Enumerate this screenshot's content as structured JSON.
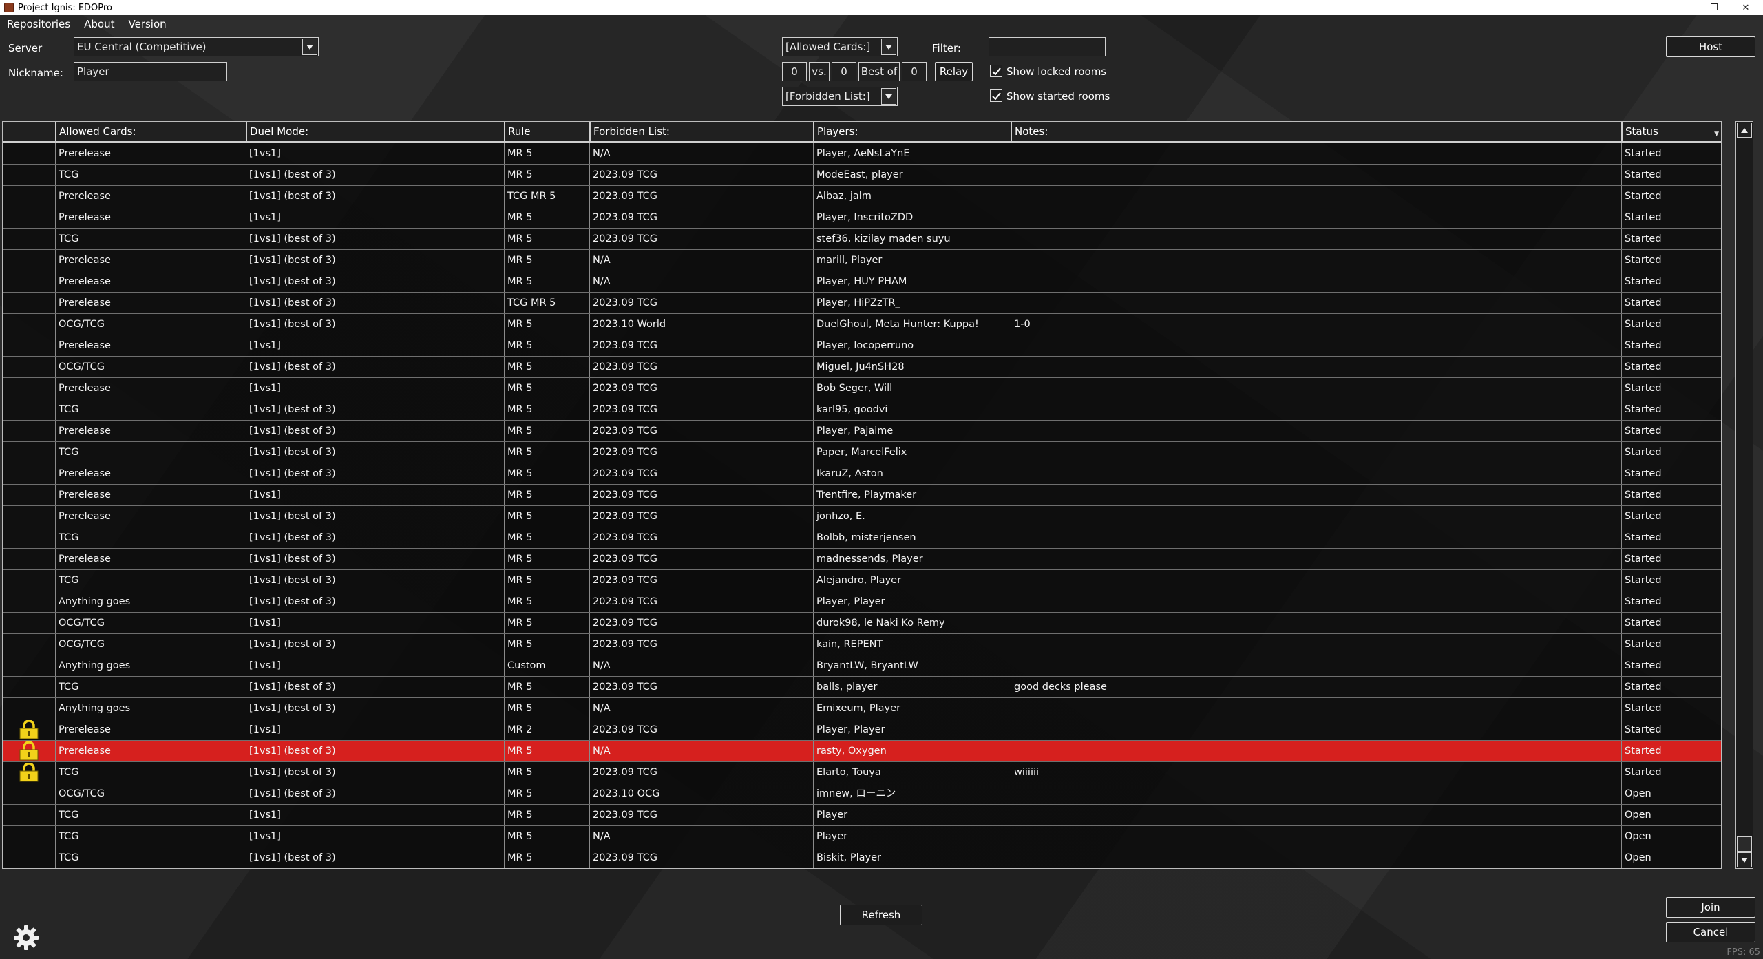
{
  "window": {
    "title": "Project Ignis: EDOPro",
    "controls": {
      "minimize": "—",
      "maximize": "❐",
      "close": "✕"
    }
  },
  "menu": [
    "Repositories",
    "About",
    "Version"
  ],
  "server": {
    "label": "Server",
    "value": "EU Central (Competitive)"
  },
  "nickname": {
    "label": "Nickname:",
    "value": "Player"
  },
  "filters": {
    "allowed_cards": "[Allowed Cards:]",
    "forbidden_list": "[Forbidden List:]",
    "vs_left": "0",
    "vs_label": "vs.",
    "vs_right": "0",
    "best_of_label": "Best of",
    "best_of_value": "0",
    "relay_label": "Relay",
    "filter_label": "Filter:",
    "filter_value": "",
    "show_locked_rooms": {
      "label": "Show locked rooms",
      "checked": true
    },
    "show_started_rooms": {
      "label": "Show started rooms",
      "checked": true
    }
  },
  "buttons": {
    "host": "Host",
    "refresh": "Refresh",
    "join": "Join",
    "cancel": "Cancel"
  },
  "table": {
    "columns": [
      "",
      "Allowed Cards:",
      "Duel Mode:",
      "Rule",
      "Forbidden List:",
      "Players:",
      "Notes:",
      "Status"
    ],
    "sort_indicator": "▼",
    "rows": [
      {
        "locked": false,
        "selected": false,
        "allowed": "Prerelease",
        "mode": "[1vs1]",
        "rule": "MR 5",
        "banlist": "N/A",
        "players": "Player, AeNsLaYnE",
        "notes": "",
        "status": "Started"
      },
      {
        "locked": false,
        "selected": false,
        "allowed": "TCG",
        "mode": "[1vs1] (best of 3)",
        "rule": "MR 5",
        "banlist": "2023.09 TCG",
        "players": "ModeEast, player",
        "notes": "",
        "status": "Started"
      },
      {
        "locked": false,
        "selected": false,
        "allowed": "Prerelease",
        "mode": "[1vs1] (best of 3)",
        "rule": "TCG MR 5",
        "banlist": "2023.09 TCG",
        "players": "Albaz, jalm",
        "notes": "",
        "status": "Started"
      },
      {
        "locked": false,
        "selected": false,
        "allowed": "Prerelease",
        "mode": "[1vs1]",
        "rule": "MR 5",
        "banlist": "2023.09 TCG",
        "players": "Player, InscritoZDD",
        "notes": "",
        "status": "Started"
      },
      {
        "locked": false,
        "selected": false,
        "allowed": "TCG",
        "mode": "[1vs1] (best of 3)",
        "rule": "MR 5",
        "banlist": "2023.09 TCG",
        "players": "stef36, kizilay maden suyu",
        "notes": "",
        "status": "Started"
      },
      {
        "locked": false,
        "selected": false,
        "allowed": "Prerelease",
        "mode": "[1vs1] (best of 3)",
        "rule": "MR 5",
        "banlist": "N/A",
        "players": "marill, Player",
        "notes": "",
        "status": "Started"
      },
      {
        "locked": false,
        "selected": false,
        "allowed": "Prerelease",
        "mode": "[1vs1] (best of 3)",
        "rule": "MR 5",
        "banlist": "N/A",
        "players": "Player, HUY PHAM",
        "notes": "",
        "status": "Started"
      },
      {
        "locked": false,
        "selected": false,
        "allowed": "Prerelease",
        "mode": "[1vs1] (best of 3)",
        "rule": "TCG MR 5",
        "banlist": "2023.09 TCG",
        "players": "Player, HiPZzTR_",
        "notes": "",
        "status": "Started"
      },
      {
        "locked": false,
        "selected": false,
        "allowed": "OCG/TCG",
        "mode": "[1vs1] (best of 3)",
        "rule": "MR 5",
        "banlist": "2023.10 World",
        "players": "DuelGhoul, Meta Hunter: Kuppa!",
        "notes": "1-0",
        "status": "Started"
      },
      {
        "locked": false,
        "selected": false,
        "allowed": "Prerelease",
        "mode": "[1vs1]",
        "rule": "MR 5",
        "banlist": "2023.09 TCG",
        "players": "Player, locoperruno",
        "notes": "",
        "status": "Started"
      },
      {
        "locked": false,
        "selected": false,
        "allowed": "OCG/TCG",
        "mode": "[1vs1] (best of 3)",
        "rule": "MR 5",
        "banlist": "2023.09 TCG",
        "players": "Miguel, Ju4nSH28",
        "notes": "",
        "status": "Started"
      },
      {
        "locked": false,
        "selected": false,
        "allowed": "Prerelease",
        "mode": "[1vs1]",
        "rule": "MR 5",
        "banlist": "2023.09 TCG",
        "players": "Bob Seger, Will",
        "notes": "",
        "status": "Started"
      },
      {
        "locked": false,
        "selected": false,
        "allowed": "TCG",
        "mode": "[1vs1] (best of 3)",
        "rule": "MR 5",
        "banlist": "2023.09 TCG",
        "players": "karl95, goodvi",
        "notes": "",
        "status": "Started"
      },
      {
        "locked": false,
        "selected": false,
        "allowed": "Prerelease",
        "mode": "[1vs1] (best of 3)",
        "rule": "MR 5",
        "banlist": "2023.09 TCG",
        "players": "Player, Pajaime",
        "notes": "",
        "status": "Started"
      },
      {
        "locked": false,
        "selected": false,
        "allowed": "TCG",
        "mode": "[1vs1] (best of 3)",
        "rule": "MR 5",
        "banlist": "2023.09 TCG",
        "players": "Paper, MarcelFelix",
        "notes": "",
        "status": "Started"
      },
      {
        "locked": false,
        "selected": false,
        "allowed": "Prerelease",
        "mode": "[1vs1] (best of 3)",
        "rule": "MR 5",
        "banlist": "2023.09 TCG",
        "players": "IkaruZ, Aston",
        "notes": "",
        "status": "Started"
      },
      {
        "locked": false,
        "selected": false,
        "allowed": "Prerelease",
        "mode": "[1vs1]",
        "rule": "MR 5",
        "banlist": "2023.09 TCG",
        "players": "Trentfire, Playmaker",
        "notes": "",
        "status": "Started"
      },
      {
        "locked": false,
        "selected": false,
        "allowed": "Prerelease",
        "mode": "[1vs1] (best of 3)",
        "rule": "MR 5",
        "banlist": "2023.09 TCG",
        "players": "jonhzo, E.",
        "notes": "",
        "status": "Started"
      },
      {
        "locked": false,
        "selected": false,
        "allowed": "TCG",
        "mode": "[1vs1] (best of 3)",
        "rule": "MR 5",
        "banlist": "2023.09 TCG",
        "players": "Bolbb, misterjensen",
        "notes": "",
        "status": "Started"
      },
      {
        "locked": false,
        "selected": false,
        "allowed": "Prerelease",
        "mode": "[1vs1] (best of 3)",
        "rule": "MR 5",
        "banlist": "2023.09 TCG",
        "players": "madnessends, Player",
        "notes": "",
        "status": "Started"
      },
      {
        "locked": false,
        "selected": false,
        "allowed": "TCG",
        "mode": "[1vs1] (best of 3)",
        "rule": "MR 5",
        "banlist": "2023.09 TCG",
        "players": "Alejandro, Player",
        "notes": "",
        "status": "Started"
      },
      {
        "locked": false,
        "selected": false,
        "allowed": "Anything goes",
        "mode": "[1vs1] (best of 3)",
        "rule": "MR 5",
        "banlist": "2023.09 TCG",
        "players": "Player, Player",
        "notes": "",
        "status": "Started"
      },
      {
        "locked": false,
        "selected": false,
        "allowed": "OCG/TCG",
        "mode": "[1vs1]",
        "rule": "MR 5",
        "banlist": "2023.09 TCG",
        "players": "durok98, le Naki Ko Remy",
        "notes": "",
        "status": "Started"
      },
      {
        "locked": false,
        "selected": false,
        "allowed": "OCG/TCG",
        "mode": "[1vs1] (best of 3)",
        "rule": "MR 5",
        "banlist": "2023.09 TCG",
        "players": "kain, REPENT",
        "notes": "",
        "status": "Started"
      },
      {
        "locked": false,
        "selected": false,
        "allowed": "Anything goes",
        "mode": "[1vs1]",
        "rule": "Custom",
        "banlist": "N/A",
        "players": "BryantLW, BryantLW",
        "notes": "",
        "status": "Started"
      },
      {
        "locked": false,
        "selected": false,
        "allowed": "TCG",
        "mode": "[1vs1] (best of 3)",
        "rule": "MR 5",
        "banlist": "2023.09 TCG",
        "players": "balls, player",
        "notes": "good decks please",
        "status": "Started"
      },
      {
        "locked": false,
        "selected": false,
        "allowed": "Anything goes",
        "mode": "[1vs1] (best of 3)",
        "rule": "MR 5",
        "banlist": "N/A",
        "players": "Emixeum, Player",
        "notes": "",
        "status": "Started"
      },
      {
        "locked": true,
        "selected": false,
        "allowed": "Prerelease",
        "mode": "[1vs1]",
        "rule": "MR 2",
        "banlist": "2023.09 TCG",
        "players": "Player, Player",
        "notes": "",
        "status": "Started"
      },
      {
        "locked": true,
        "selected": true,
        "allowed": "Prerelease",
        "mode": "[1vs1] (best of 3)",
        "rule": "MR 5",
        "banlist": "N/A",
        "players": "rasty, Oxygen",
        "notes": "",
        "status": "Started"
      },
      {
        "locked": true,
        "selected": false,
        "allowed": "TCG",
        "mode": "[1vs1] (best of 3)",
        "rule": "MR 5",
        "banlist": "2023.09 TCG",
        "players": "Elarto, Touya",
        "notes": "wiiiiii",
        "status": "Started"
      },
      {
        "locked": false,
        "selected": false,
        "allowed": "OCG/TCG",
        "mode": "[1vs1] (best of 3)",
        "rule": "MR 5",
        "banlist": "2023.10 OCG",
        "players": "imnew, ローニン",
        "notes": "",
        "status": "Open"
      },
      {
        "locked": false,
        "selected": false,
        "allowed": "TCG",
        "mode": "[1vs1]",
        "rule": "MR 5",
        "banlist": "2023.09 TCG",
        "players": "Player",
        "notes": "",
        "status": "Open"
      },
      {
        "locked": false,
        "selected": false,
        "allowed": "TCG",
        "mode": "[1vs1]",
        "rule": "MR 5",
        "banlist": "N/A",
        "players": "Player",
        "notes": "",
        "status": "Open"
      },
      {
        "locked": false,
        "selected": false,
        "allowed": "TCG",
        "mode": "[1vs1] (best of 3)",
        "rule": "MR 5",
        "banlist": "2023.09 TCG",
        "players": "Biskit, Player",
        "notes": "",
        "status": "Open"
      }
    ]
  },
  "colors": {
    "selected_row": "#d6201e",
    "lock_icon": "#f2d21a"
  },
  "icons": {
    "settings": "gear-icon",
    "lock": "lock-icon",
    "dropdown": "chevron-down-icon"
  },
  "fps": "FPS: 65"
}
